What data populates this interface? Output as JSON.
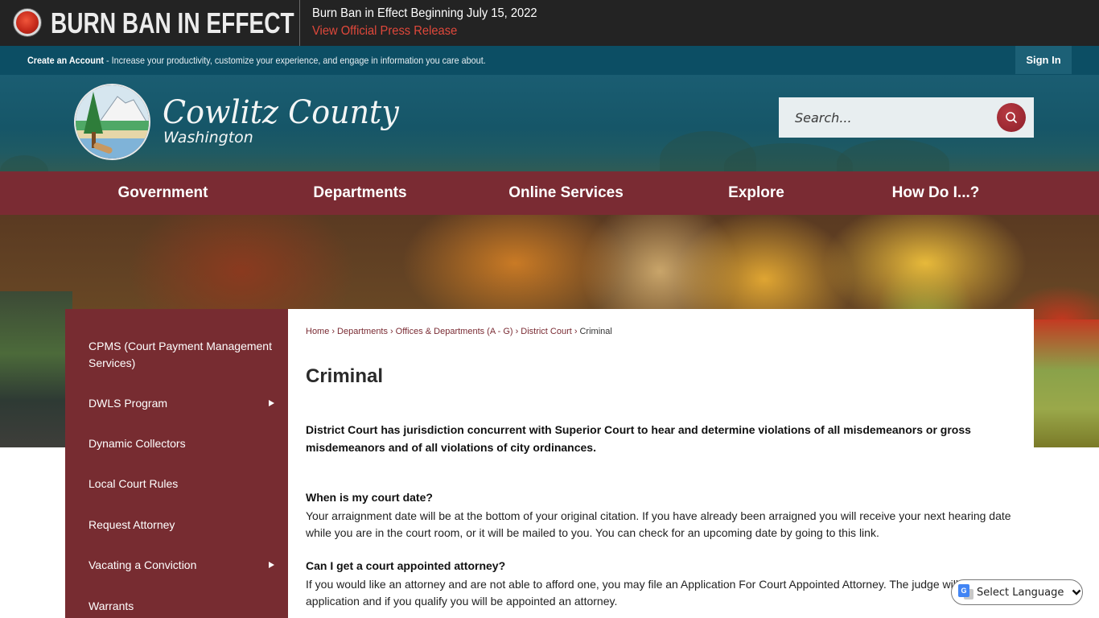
{
  "alert": {
    "title": "BURN BAN IN EFFECT",
    "message": "Burn Ban in Effect Beginning July 15, 2022",
    "link": "View Official Press Release"
  },
  "account_bar": {
    "create_account": "Create an Account",
    "description": " - Increase your productivity, customize your experience, and engage in information you care about.",
    "sign_in": "Sign In"
  },
  "header": {
    "logo_title": "Cowlitz County",
    "logo_subtitle": "Washington",
    "search_placeholder": "Search..."
  },
  "nav": {
    "items": [
      {
        "label": "Government"
      },
      {
        "label": "Departments"
      },
      {
        "label": "Online Services"
      },
      {
        "label": "Explore"
      },
      {
        "label": "How Do I...?"
      }
    ]
  },
  "sidebar": {
    "items": [
      {
        "label": "CPMS (Court Payment Management Services)",
        "has_submenu": false
      },
      {
        "label": "DWLS Program",
        "has_submenu": true
      },
      {
        "label": "Dynamic Collectors",
        "has_submenu": false
      },
      {
        "label": "Local Court Rules",
        "has_submenu": false
      },
      {
        "label": "Request Attorney",
        "has_submenu": false
      },
      {
        "label": "Vacating a Conviction",
        "has_submenu": true
      },
      {
        "label": "Warrants",
        "has_submenu": false
      }
    ]
  },
  "breadcrumb": {
    "items": [
      "Home",
      "Departments",
      "Offices & Departments (A - G)",
      "District Court"
    ],
    "current": "Criminal",
    "separator": "›"
  },
  "content": {
    "title": "Criminal",
    "intro": " District Court has jurisdiction concurrent with Superior Court to hear and determine violations of all misdemeanors or gross misdemeanors and of all violations of city ordinances.",
    "faqs": [
      {
        "question": " When is my court date?",
        "answer": "Your arraignment date will be at the bottom of your original citation. If you have already been arraigned you will receive your next hearing date while you are in the court room, or it will be mailed to you. You can check for an upcoming date by going to this link."
      },
      {
        "question": "Can I get a court appointed attorney?",
        "answer": "If you would like an attorney and are not able to afford one, you may file an Application For Court Appointed Attorney. The judge will review the application and if you qualify you will be appointed an attorney."
      }
    ]
  },
  "translate": {
    "label": "Select Language"
  },
  "colors": {
    "alert_bg": "#232323",
    "alert_link": "#e0483b",
    "teal": "#0c4e64",
    "maroon": "#7a2b33",
    "sidebar": "#772c31"
  }
}
